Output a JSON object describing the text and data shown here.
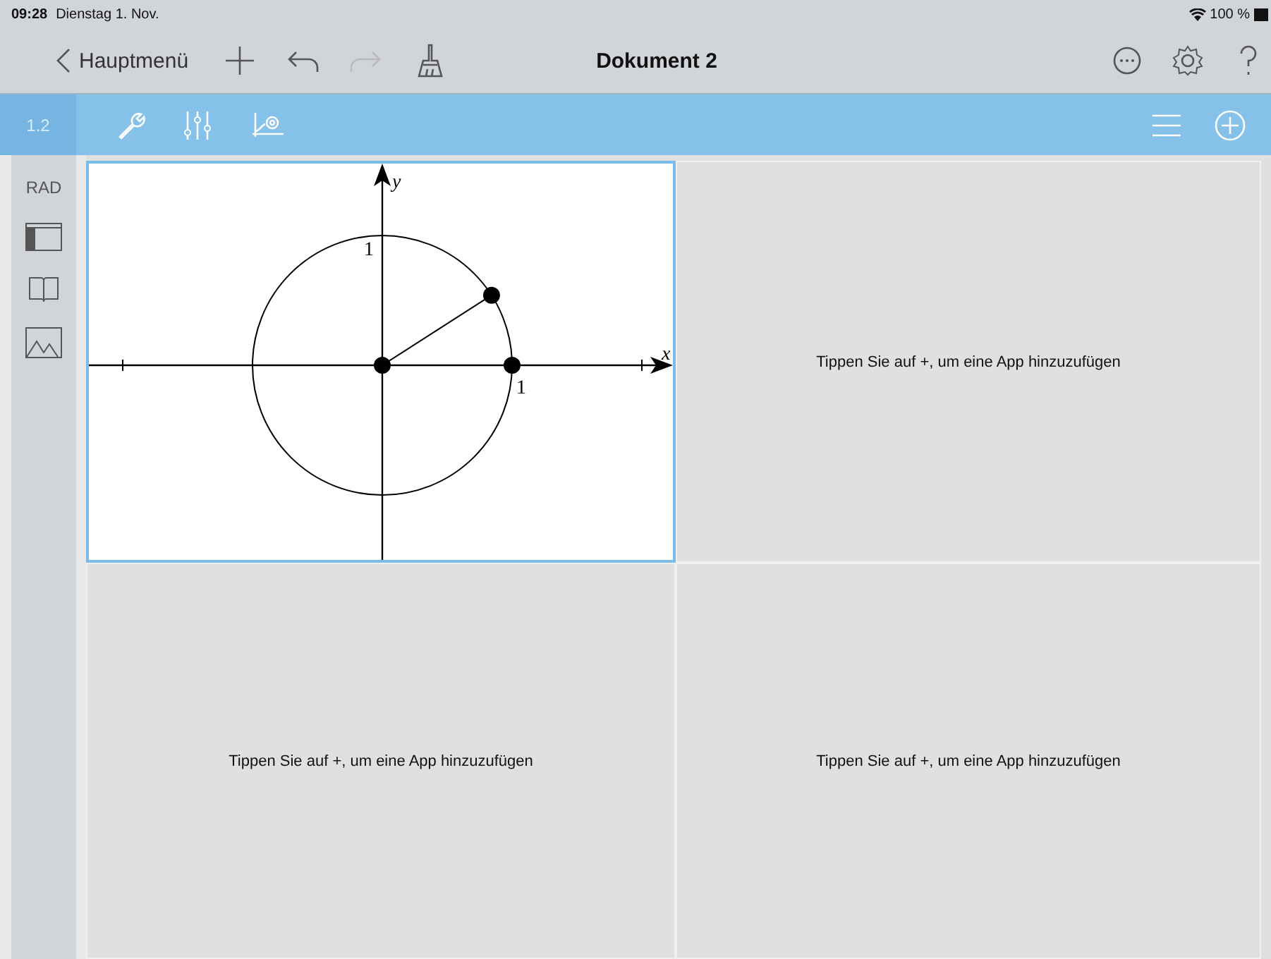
{
  "status_bar": {
    "time": "09:28",
    "date": "Dienstag 1. Nov.",
    "battery": "100 %"
  },
  "nav": {
    "back": "Hauptmenü",
    "title": "Dokument 2",
    "redo_disabled": true
  },
  "toolbar": {
    "page": "1.2"
  },
  "sidebar": {
    "mode": "RAD"
  },
  "panes": [
    {
      "kind": "graph",
      "selected": true,
      "x_label": "x",
      "y_label": "y",
      "x_tick_label": "1",
      "y_tick_label": "1"
    },
    {
      "kind": "empty",
      "selected": false,
      "text": "Tippen Sie auf +, um eine App hinzuzufügen"
    },
    {
      "kind": "empty",
      "selected": false,
      "text": "Tippen Sie auf +, um eine App hinzuzufügen"
    },
    {
      "kind": "empty",
      "selected": false,
      "text": "Tippen Sie auf +, um eine App hinzuzufügen"
    }
  ]
}
